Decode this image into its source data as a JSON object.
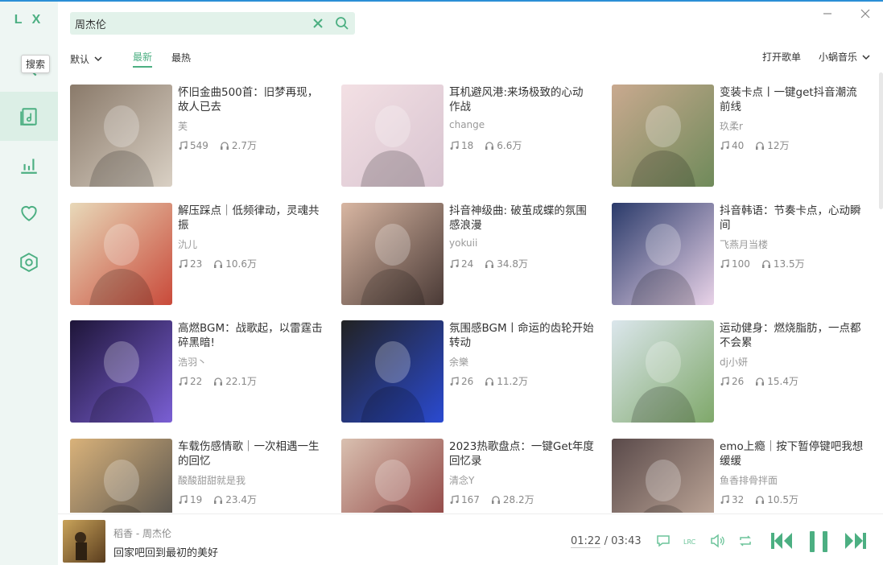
{
  "app": {
    "logo": "L X",
    "tooltip": "搜索"
  },
  "search": {
    "value": "周杰伦"
  },
  "filters": {
    "sort_label": "默认",
    "tabs": [
      "最新",
      "最热"
    ],
    "open_playlist": "打开歌单",
    "source": "小蜗音乐"
  },
  "playlists": [
    {
      "title": "怀旧金曲500首：旧梦再现，故人已去",
      "author": "芙",
      "songs": "549",
      "plays": "2.7万"
    },
    {
      "title": "耳机避风港:来场极致的心动作战",
      "author": "change",
      "songs": "18",
      "plays": "6.6万"
    },
    {
      "title": "变装卡点丨一键get抖音潮流前线",
      "author": "玖柔r",
      "songs": "40",
      "plays": "12万"
    },
    {
      "title": "解压踩点｜低频律动，灵魂共振",
      "author": "氿儿",
      "songs": "23",
      "plays": "10.6万"
    },
    {
      "title": "抖音神级曲: 破茧成蝶的氛围感浪漫",
      "author": "yokuii",
      "songs": "24",
      "plays": "34.8万"
    },
    {
      "title": "抖音韩语：节奏卡点，心动瞬间",
      "author": "飞燕月当楼",
      "songs": "100",
      "plays": "13.5万"
    },
    {
      "title": "高燃BGM：战歌起，以雷霆击碎黑暗!",
      "author": "浩羽丶",
      "songs": "22",
      "plays": "22.1万"
    },
    {
      "title": "氛围感BGM丨命运的齿轮开始转动",
      "author": "余樂",
      "songs": "26",
      "plays": "11.2万"
    },
    {
      "title": "运动健身：燃烧脂肪，一点都不会累",
      "author": "dj小妍",
      "songs": "26",
      "plays": "15.4万"
    },
    {
      "title": "车载伤感情歌｜一次相遇一生的回忆",
      "author": "酸酸甜甜就是我",
      "songs": "19",
      "plays": "23.4万"
    },
    {
      "title": "2023热歌盘点：一键Get年度回忆录",
      "author": "清念Y",
      "songs": "167",
      "plays": "28.2万"
    },
    {
      "title": "emo上瘾｜按下暂停键吧我想缓缓",
      "author": "鱼香排骨拌面",
      "songs": "32",
      "plays": "10.5万"
    }
  ],
  "player": {
    "song": "稻香 - 周杰伦",
    "lyric": "回家吧回到最初的美好",
    "current_time": "01:22",
    "separator": "/",
    "total_time": "03:43",
    "lrc_label": "LRC"
  },
  "colors": {
    "accent": "#4caf82",
    "sidebar_bg": "#eef6f3",
    "search_bg": "#e2f2ea"
  }
}
